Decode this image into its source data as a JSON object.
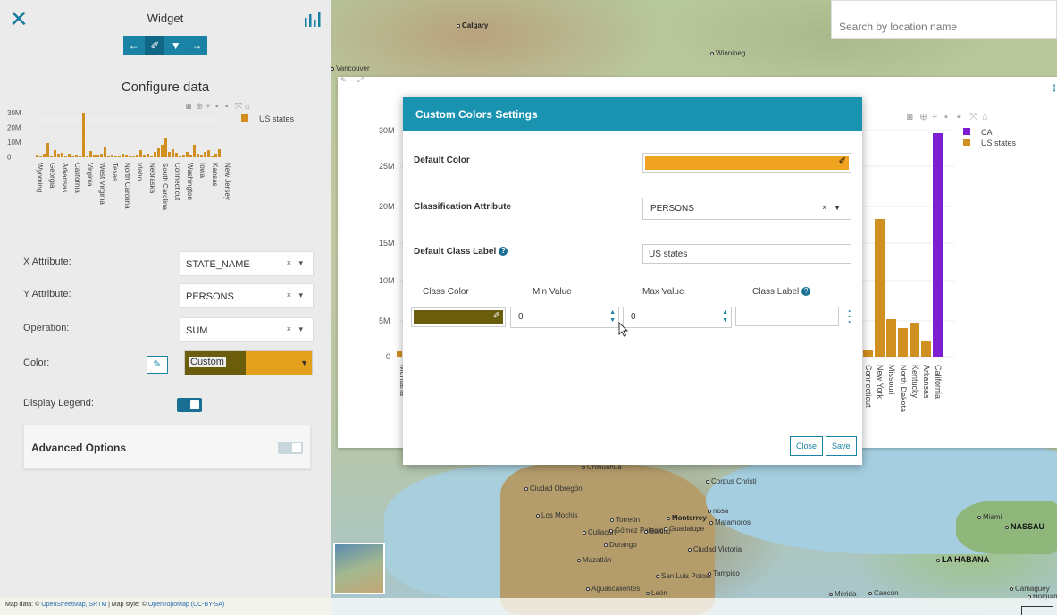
{
  "panel": {
    "title": "Widget",
    "configure_title": "Configure data",
    "toolbar": [
      "←",
      "✐",
      "▼",
      "→"
    ],
    "mini_chart": {
      "y_ticks": [
        "30M",
        "20M",
        "10M",
        "0"
      ],
      "legend": "US states",
      "categories": [
        "Wyoming",
        "Georgia",
        "Arkansas",
        "California",
        "Virginia",
        "West Virginia",
        "Texas",
        "North Carolina",
        "Idaho",
        "Nebraska",
        "South Carolina",
        "Connecticut",
        "Washington",
        "Iowa",
        "Kansas",
        "New Jersey"
      ]
    },
    "x_attribute": {
      "label": "X Attribute:",
      "value": "STATE_NAME"
    },
    "y_attribute": {
      "label": "Y Attribute:",
      "value": "PERSONS"
    },
    "operation": {
      "label": "Operation:",
      "value": "SUM"
    },
    "color": {
      "label": "Color:",
      "value": "Custom"
    },
    "display_legend": {
      "label": "Display Legend:"
    },
    "advanced_options": "Advanced Options",
    "select_ctrl": "× ▾"
  },
  "map": {
    "search_placeholder": "Search by location name",
    "labels": [
      {
        "text": "Calgary",
        "cls": "map-label"
      },
      {
        "text": "Winnipeg",
        "cls": "map-label small"
      },
      {
        "text": "Vancouver",
        "cls": "map-label small"
      },
      {
        "text": "Chihuahua",
        "cls": "map-label small"
      },
      {
        "text": "Ciudad Obregón",
        "cls": "map-label small"
      },
      {
        "text": "Corpus Christi",
        "cls": "map-label small"
      },
      {
        "text": "Los Mochis",
        "cls": "map-label small"
      },
      {
        "text": "Torreón",
        "cls": "map-label small"
      },
      {
        "text": "Monterrey",
        "cls": "map-label"
      },
      {
        "text": "Matamoros",
        "cls": "map-label small"
      },
      {
        "text": "Culiacán",
        "cls": "map-label small"
      },
      {
        "text": "Gómez Palacio",
        "cls": "map-label small"
      },
      {
        "text": "Saltillo",
        "cls": "map-label small"
      },
      {
        "text": "Guadalupe",
        "cls": "map-label small"
      },
      {
        "text": "Durango",
        "cls": "map-label small"
      },
      {
        "text": "Ciudad Victoria",
        "cls": "map-label small"
      },
      {
        "text": "Mazatlán",
        "cls": "map-label small"
      },
      {
        "text": "San Luis Potosí",
        "cls": "map-label small"
      },
      {
        "text": "Tampico",
        "cls": "map-label small"
      },
      {
        "text": "Aguascalientes",
        "cls": "map-label small"
      },
      {
        "text": "León",
        "cls": "map-label small"
      },
      {
        "text": "Miami",
        "cls": "map-label small"
      },
      {
        "text": "NASSAU",
        "cls": "map-label cap"
      },
      {
        "text": "LA HABANA",
        "cls": "map-label cap"
      },
      {
        "text": "Mérida",
        "cls": "map-label small"
      },
      {
        "text": "Cancún",
        "cls": "map-label small"
      },
      {
        "text": "Camagüey",
        "cls": "map-label small"
      },
      {
        "text": "Holguín",
        "cls": "map-label small"
      },
      {
        "text": "nosa",
        "cls": "map-label small"
      }
    ],
    "attribution_prefix": "Map data: © ",
    "attribution_link1": "OpenStreetMap, SRTM",
    "attribution_mid": " | Map style: © ",
    "attribution_link2": "OpenTopoMap (CC-BY-SA)"
  },
  "big_chart": {
    "y_ticks": [
      "30M",
      "25M",
      "20M",
      "15M",
      "10M",
      "5M",
      "0"
    ],
    "legend": [
      {
        "name": "CA",
        "color": "#7b1fd1"
      },
      {
        "name": "US states",
        "color": "#d18f1f"
      }
    ],
    "left_category": "Montana",
    "categories": [
      "Connecticut",
      "New York",
      "Missouri",
      "North Dakota",
      "Kentucky",
      "Arkansas",
      "California"
    ]
  },
  "modal": {
    "title": "Custom Colors Settings",
    "default_color_label": "Default Color",
    "default_color": "#f0a422",
    "classification_label": "Classification Attribute",
    "classification_value": "PERSONS",
    "default_class_label_label": "Default Class Label",
    "default_class_label_value": "US states",
    "columns": {
      "class_color": "Class Color",
      "min_value": "Min Value",
      "max_value": "Max Value",
      "class_label": "Class Label"
    },
    "row": {
      "color": "#6a5d0c",
      "min": "0",
      "max": "0",
      "label": ""
    },
    "close": "Close",
    "save": "Save",
    "help": "?"
  }
}
